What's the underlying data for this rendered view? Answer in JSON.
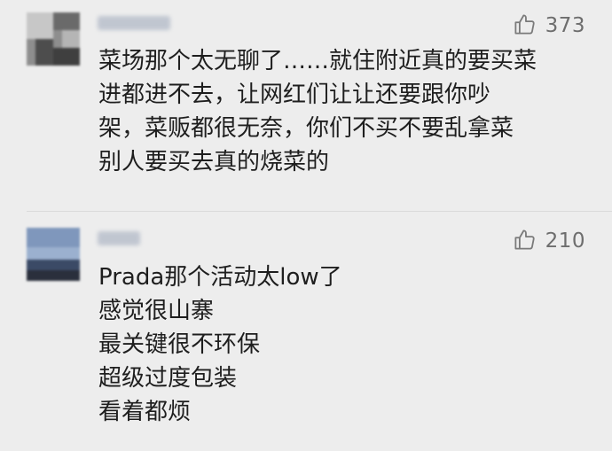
{
  "comments": [
    {
      "likes": "373",
      "lines": [
        "菜场那个太无聊了……就住附近真的要买菜",
        "进都进不去，让网红们让让还要跟你吵",
        "架，菜贩都很无奈，你们不买不要乱拿菜",
        "别人要买去真的烧菜的"
      ]
    },
    {
      "likes": "210",
      "lines": [
        "Prada那个活动太low了",
        "感觉很山寨",
        "最关键很不环保",
        "超级过度包装",
        "看着都烦"
      ]
    }
  ],
  "icons": {
    "like": "thumbs-up-icon"
  },
  "colors": {
    "background": "#ededed",
    "text": "#1e1e1e",
    "like_text": "#6e6e6e"
  }
}
